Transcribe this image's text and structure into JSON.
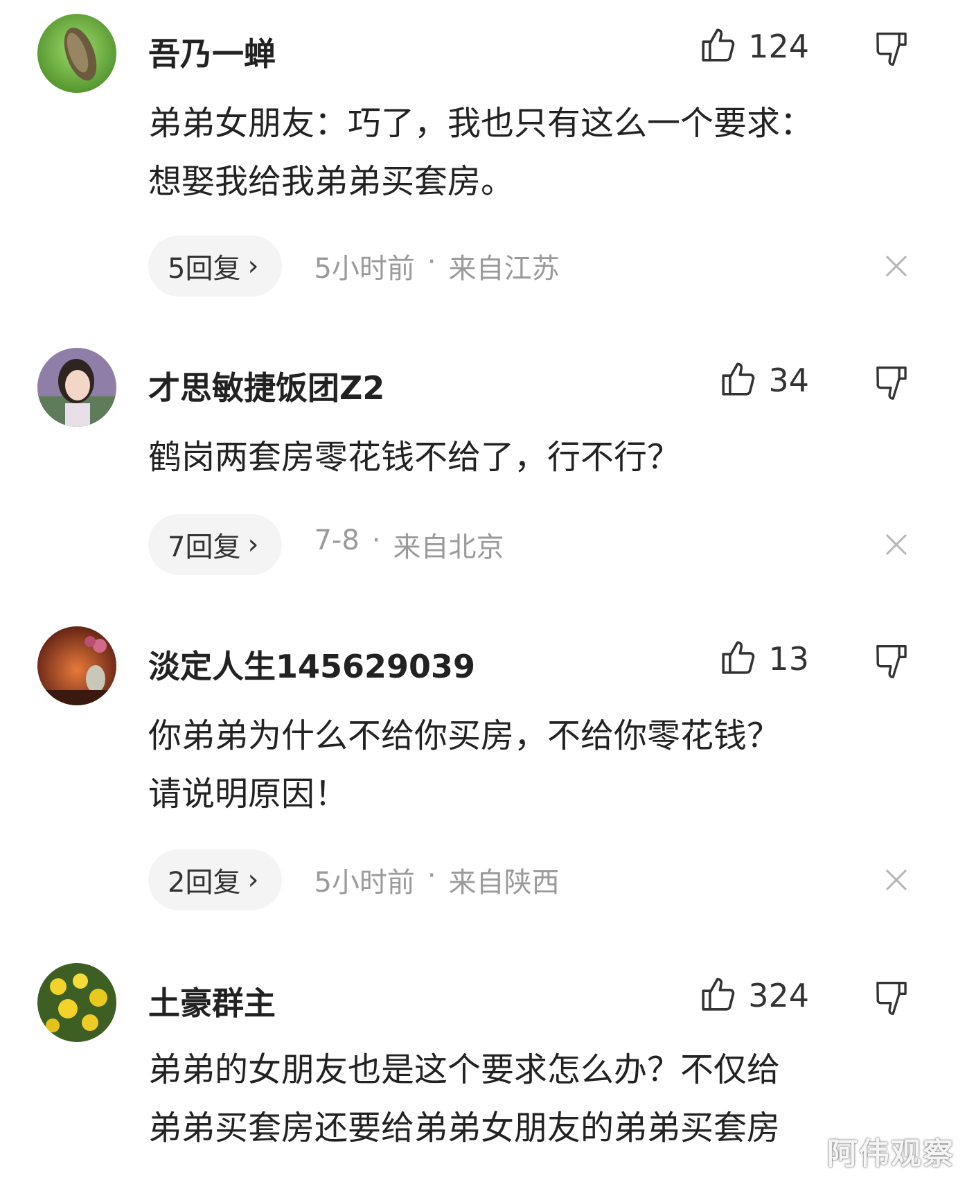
{
  "comments": [
    {
      "username": "吾乃一蝉",
      "likes": "124",
      "content_lines": [
        "弟弟女朋友：巧了，我也只有这么一个要求：",
        "想娶我给我弟弟买套房。"
      ],
      "reply_label": "5回复",
      "time": "5小时前",
      "location": "来自江苏"
    },
    {
      "username": "才思敏捷饭团Z2",
      "likes": "34",
      "content_lines": [
        "鹤岗两套房零花钱不给了，行不行？"
      ],
      "reply_label": "7回复",
      "time": "7-8",
      "location": "来自北京"
    },
    {
      "username": "淡定人生145629039",
      "likes": "13",
      "content_lines": [
        "你弟弟为什么不给你买房，不给你零花钱？",
        "请说明原因！"
      ],
      "reply_label": "2回复",
      "time": "5小时前",
      "location": "来自陕西"
    },
    {
      "username": "土豪群主",
      "likes": "324",
      "content_lines": [
        "弟弟的女朋友也是这个要求怎么办？不仅给",
        "弟弟买套房还要给弟弟女朋友的弟弟买套房"
      ]
    }
  ],
  "separator": "·",
  "watermark": "阿伟观察",
  "icons": {
    "like": "thumb-up-icon",
    "dislike": "thumb-down-icon",
    "close": "close-icon",
    "reply_chevron": "chevron-right-icon"
  },
  "colors": {
    "text": "#222222",
    "meta": "#9a9a9a",
    "reply_bg": "#f4f4f4"
  }
}
